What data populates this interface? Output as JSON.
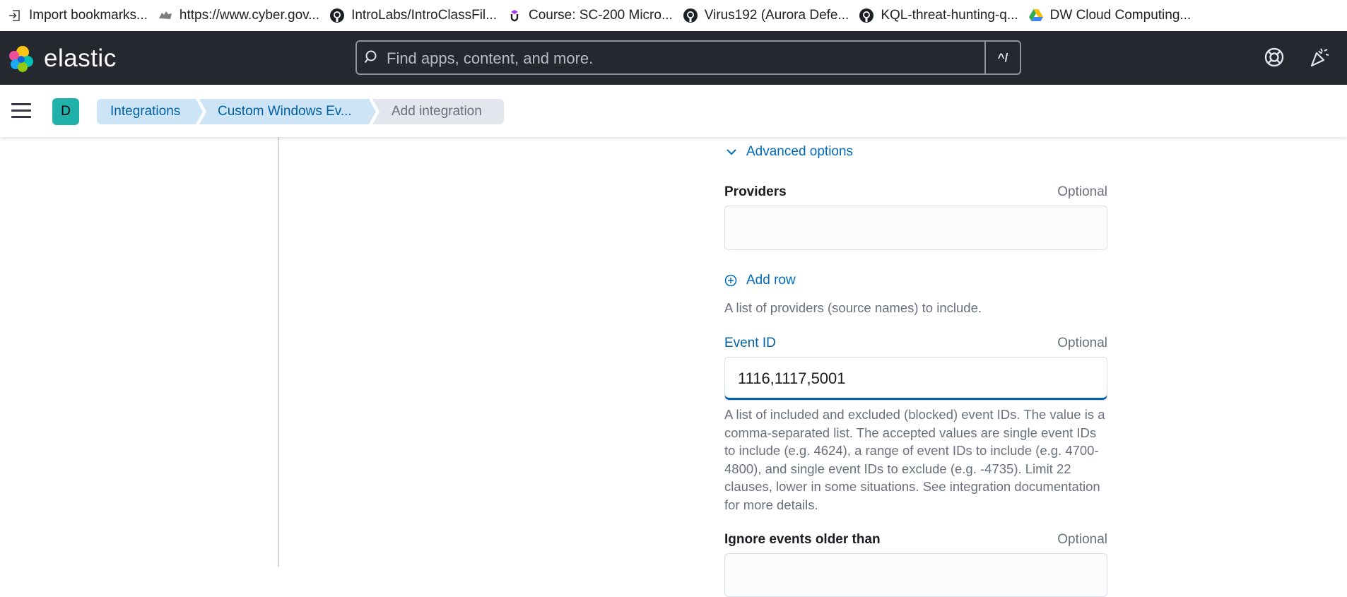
{
  "bookmarks": [
    {
      "icon": "import-icon",
      "label": "Import bookmarks..."
    },
    {
      "icon": "site-icon",
      "label": "https://www.cyber.gov..."
    },
    {
      "icon": "github-icon",
      "label": "IntroLabs/IntroClassFil..."
    },
    {
      "icon": "udemy-icon",
      "label": "Course: SC-200 Micro..."
    },
    {
      "icon": "github-icon",
      "label": "Virus192 (Aurora Defe..."
    },
    {
      "icon": "github-icon",
      "label": "KQL-threat-hunting-q..."
    },
    {
      "icon": "drive-icon",
      "label": "DW Cloud Computing..."
    }
  ],
  "header": {
    "logo_text": "elastic",
    "search_placeholder": "Find apps, content, and more.",
    "search_shortcut": "^/"
  },
  "breadcrumbs": {
    "space_initial": "D",
    "items": [
      "Integrations",
      "Custom Windows Ev...",
      "Add integration"
    ]
  },
  "form": {
    "advanced_toggle": "Advanced options",
    "providers": {
      "label": "Providers",
      "optional": "Optional",
      "value": "",
      "add_row": "Add row",
      "help": "A list of providers (source names) to include."
    },
    "event_id": {
      "label": "Event ID",
      "optional": "Optional",
      "value": "1116,1117,5001",
      "help": "A list of included and excluded (blocked) event IDs. The value is a comma-separated list. The accepted values are single event IDs to include (e.g. 4624), a range of event IDs to include (e.g. 4700-4800), and single event IDs to exclude (e.g. -4735). Limit 22 clauses, lower in some situations. See integration documentation for more details."
    },
    "ignore_older": {
      "label": "Ignore events older than",
      "optional": "Optional"
    }
  },
  "colors": {
    "header_bg": "#25282f",
    "link": "#006bb8",
    "crumb_bg": "#cce4f5",
    "avatar": "#20b2aa"
  }
}
